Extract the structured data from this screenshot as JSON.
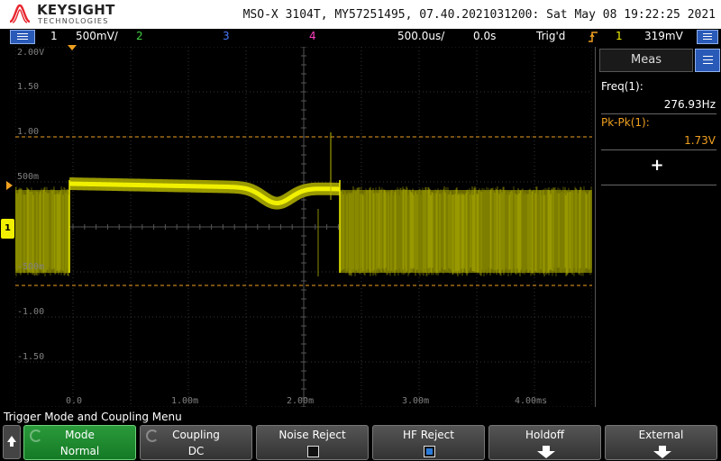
{
  "header": {
    "brand": "KEYSIGHT",
    "brand_sub": "TECHNOLOGIES",
    "title": "MSO-X 3104T, MY57251495, 07.40.2021031200: Sat May 08 19:22:25 2021"
  },
  "status": {
    "ch1_num": "1",
    "ch1_scale": "500mV/",
    "ch2_num": "2",
    "ch3_num": "3",
    "ch4_num": "4",
    "timebase": "500.0us/",
    "delay": "0.0s",
    "trig_state": "Trig'd",
    "trig_source": "1",
    "trig_level": "319mV",
    "colors": {
      "ch1": "#f0f000",
      "ch2": "#40d040",
      "ch3": "#4a7aff",
      "ch4": "#ff40c0",
      "trigger": "#f0a020"
    }
  },
  "graticule": {
    "y_labels": [
      "2.00V",
      "1.50",
      "1.00",
      "500m",
      "-500m",
      "-1.00",
      "-1.50"
    ],
    "x_labels": [
      "0.0",
      "1.00m",
      "2.00m",
      "3.00m",
      "4.00ms"
    ],
    "cursor_levels_v": [
      1.0,
      -0.65
    ],
    "y_range_v": [
      -2.0,
      2.0
    ],
    "x_range_ms": [
      -0.6,
      5.8
    ]
  },
  "trace": {
    "channel": "1",
    "color": "#f0f000",
    "burst_segments_ms": [
      [
        -0.6,
        0.0
      ],
      [
        3.0,
        5.8
      ]
    ],
    "burst_range_v": [
      -0.55,
      0.45
    ],
    "quiet_level_v": 0.48,
    "quiet_dip_v": 0.28,
    "quiet_dip_center_ms": 2.3
  },
  "meas": {
    "tab_label": "Meas",
    "items": [
      {
        "label": "Freq(1):",
        "value": "276.93Hz",
        "color": "#ffffff"
      },
      {
        "label": "Pk-Pk(1):",
        "value": "1.73V",
        "color": "#f0a020"
      }
    ],
    "add_label": "+"
  },
  "menu": {
    "title": "Trigger Mode and Coupling Menu",
    "softkeys": [
      {
        "l1": "Mode",
        "l2": "Normal"
      },
      {
        "l1": "Coupling",
        "l2": "DC"
      },
      {
        "l1": "Noise Reject",
        "l2": ""
      },
      {
        "l1": "HF Reject",
        "l2": ""
      },
      {
        "l1": "Holdoff",
        "l2": ""
      },
      {
        "l1": "External",
        "l2": ""
      }
    ]
  },
  "icons": {
    "menu": "menu-icon",
    "back": "up-arrow-icon",
    "trigger_edge": "rising-edge-icon"
  }
}
